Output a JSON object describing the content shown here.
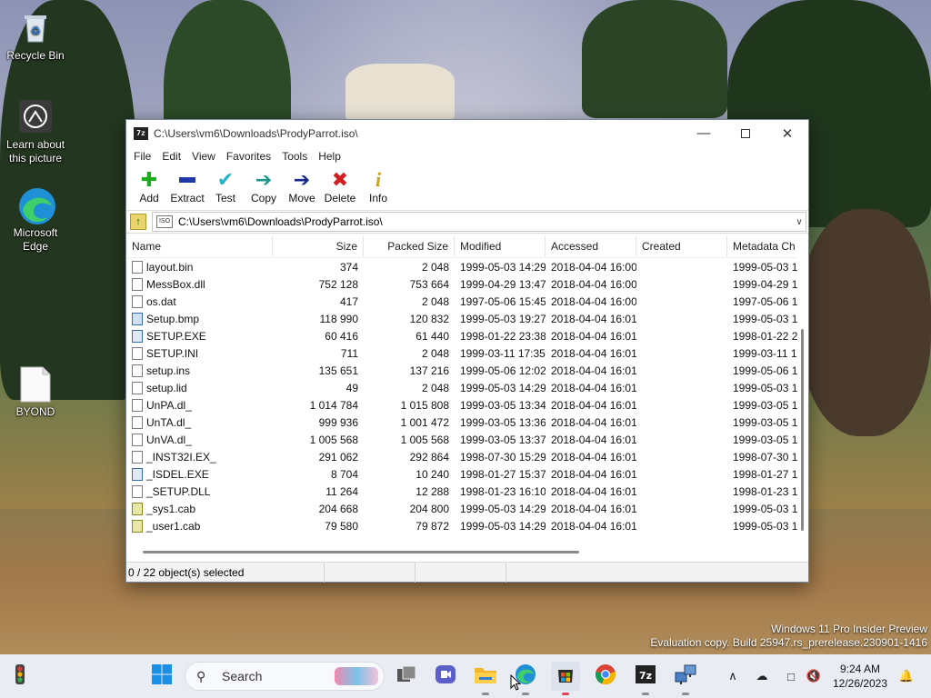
{
  "desktop": {
    "icons": [
      {
        "label": "Recycle Bin"
      },
      {
        "label": "Learn about this picture"
      },
      {
        "label": "Microsoft Edge"
      },
      {
        "label": "BYOND"
      }
    ],
    "watermark": {
      "line1": "Windows 11 Pro Insider Preview",
      "line2": "Evaluation copy. Build 25947.rs_prerelease.230901-1416"
    }
  },
  "window": {
    "app_icon_text": "7z",
    "title": "C:\\Users\\vm6\\Downloads\\ProdyParrot.iso\\",
    "menu": [
      "File",
      "Edit",
      "View",
      "Favorites",
      "Tools",
      "Help"
    ],
    "toolbar": [
      {
        "label": "Add",
        "icon": "plus-icon",
        "color": "#1faa1f"
      },
      {
        "label": "Extract",
        "icon": "minus-icon",
        "color": "#1f3aa8"
      },
      {
        "label": "Test",
        "icon": "check-icon",
        "color": "#22b3c9"
      },
      {
        "label": "Copy",
        "icon": "copy-arrow-icon",
        "color": "#1d9a8a"
      },
      {
        "label": "Move",
        "icon": "move-arrow-icon",
        "color": "#1a2a8a"
      },
      {
        "label": "Delete",
        "icon": "delete-x-icon",
        "color": "#d21f1f"
      },
      {
        "label": "Info",
        "icon": "info-icon",
        "color": "#c9a21b"
      }
    ],
    "address": {
      "path": "C:\\Users\\vm6\\Downloads\\ProdyParrot.iso\\",
      "icon_text": "ISO"
    },
    "columns": [
      "Name",
      "Size",
      "Packed Size",
      "Modified",
      "Accessed",
      "Created",
      "Metadata Ch"
    ],
    "files": [
      {
        "name": "layout.bin",
        "type": "file",
        "size": "374",
        "packed": "2 048",
        "modified": "1999-05-03 14:29",
        "accessed": "2018-04-04 16:00",
        "created": "",
        "meta": "1999-05-03 1"
      },
      {
        "name": "MessBox.dll",
        "type": "file",
        "size": "752 128",
        "packed": "753 664",
        "modified": "1999-04-29 13:47",
        "accessed": "2018-04-04 16:00",
        "created": "",
        "meta": "1999-04-29 1"
      },
      {
        "name": "os.dat",
        "type": "file",
        "size": "417",
        "packed": "2 048",
        "modified": "1997-05-06 15:45",
        "accessed": "2018-04-04 16:00",
        "created": "",
        "meta": "1997-05-06 1"
      },
      {
        "name": "Setup.bmp",
        "type": "bmp",
        "size": "118 990",
        "packed": "120 832",
        "modified": "1999-05-03 19:27",
        "accessed": "2018-04-04 16:01",
        "created": "",
        "meta": "1999-05-03 1"
      },
      {
        "name": "SETUP.EXE",
        "type": "exe",
        "size": "60 416",
        "packed": "61 440",
        "modified": "1998-01-22 23:38",
        "accessed": "2018-04-04 16:01",
        "created": "",
        "meta": "1998-01-22 2"
      },
      {
        "name": "SETUP.INI",
        "type": "file",
        "size": "711",
        "packed": "2 048",
        "modified": "1999-03-11 17:35",
        "accessed": "2018-04-04 16:01",
        "created": "",
        "meta": "1999-03-11 1"
      },
      {
        "name": "setup.ins",
        "type": "file",
        "size": "135 651",
        "packed": "137 216",
        "modified": "1999-05-06 12:02",
        "accessed": "2018-04-04 16:01",
        "created": "",
        "meta": "1999-05-06 1"
      },
      {
        "name": "setup.lid",
        "type": "file",
        "size": "49",
        "packed": "2 048",
        "modified": "1999-05-03 14:29",
        "accessed": "2018-04-04 16:01",
        "created": "",
        "meta": "1999-05-03 1"
      },
      {
        "name": "UnPA.dl_",
        "type": "file",
        "size": "1 014 784",
        "packed": "1 015 808",
        "modified": "1999-03-05 13:34",
        "accessed": "2018-04-04 16:01",
        "created": "",
        "meta": "1999-03-05 1"
      },
      {
        "name": "UnTA.dl_",
        "type": "file",
        "size": "999 936",
        "packed": "1 001 472",
        "modified": "1999-03-05 13:36",
        "accessed": "2018-04-04 16:01",
        "created": "",
        "meta": "1999-03-05 1"
      },
      {
        "name": "UnVA.dl_",
        "type": "file",
        "size": "1 005 568",
        "packed": "1 005 568",
        "modified": "1999-03-05 13:37",
        "accessed": "2018-04-04 16:01",
        "created": "",
        "meta": "1999-03-05 1"
      },
      {
        "name": "_INST32I.EX_",
        "type": "file",
        "size": "291 062",
        "packed": "292 864",
        "modified": "1998-07-30 15:29",
        "accessed": "2018-04-04 16:01",
        "created": "",
        "meta": "1998-07-30 1"
      },
      {
        "name": "_ISDEL.EXE",
        "type": "exe",
        "size": "8 704",
        "packed": "10 240",
        "modified": "1998-01-27 15:37",
        "accessed": "2018-04-04 16:01",
        "created": "",
        "meta": "1998-01-27 1"
      },
      {
        "name": "_SETUP.DLL",
        "type": "file",
        "size": "11 264",
        "packed": "12 288",
        "modified": "1998-01-23 16:10",
        "accessed": "2018-04-04 16:01",
        "created": "",
        "meta": "1998-01-23 1"
      },
      {
        "name": "_sys1.cab",
        "type": "cab",
        "size": "204 668",
        "packed": "204 800",
        "modified": "1999-05-03 14:29",
        "accessed": "2018-04-04 16:01",
        "created": "",
        "meta": "1999-05-03 1"
      },
      {
        "name": "_user1.cab",
        "type": "cab",
        "size": "79 580",
        "packed": "79 872",
        "modified": "1999-05-03 14:29",
        "accessed": "2018-04-04 16:01",
        "created": "",
        "meta": "1999-05-03 1"
      }
    ],
    "status": {
      "selected": "0 / 22 object(s) selected"
    }
  },
  "taskbar": {
    "search_placeholder": "Search",
    "time": "9:24 AM",
    "date": "12/26/2023",
    "pinned": [
      "widgets-icon",
      "start-icon",
      "search-box",
      "task-view-icon",
      "meet-icon",
      "file-explorer-icon",
      "edge-icon",
      "store-icon",
      "chrome-icon",
      "7zip-icon",
      "network-app-icon"
    ]
  }
}
